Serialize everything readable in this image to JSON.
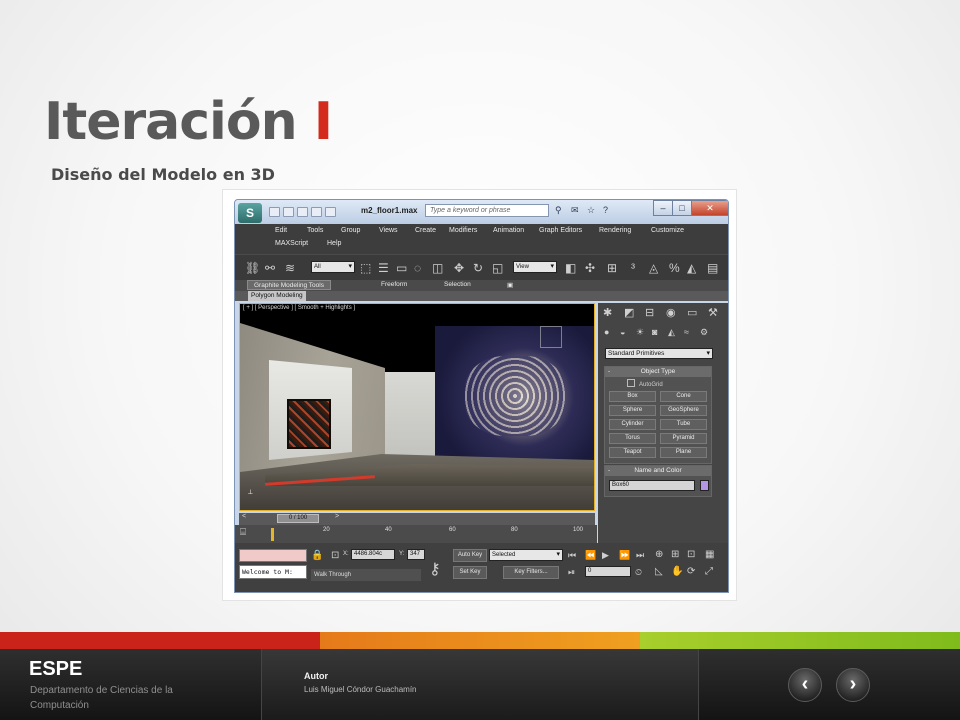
{
  "slide": {
    "title_main": "Iteración ",
    "title_accent": "I",
    "subtitle": "Diseño del Modelo en 3D"
  },
  "app": {
    "file_title": "m2_floor1.max",
    "search_placeholder": "Type a keyword or phrase",
    "menu": [
      "Edit",
      "Tools",
      "Group",
      "Views",
      "Create",
      "Modifiers",
      "Animation",
      "Graph Editors",
      "Rendering",
      "Customize",
      "MAXScript",
      "Help"
    ],
    "toolbar": {
      "filter_select": "All",
      "view_select": "View"
    },
    "ribbon_tabs": [
      "Graphite Modeling Tools",
      "Freeform",
      "Selection"
    ],
    "ribbon_sub": "Polygon Modeling",
    "viewport_label": "[ + ] [ Perspective ] [ Smooth + Highlights ]",
    "time_slider": "0 / 100",
    "ruler_ticks": [
      "20",
      "40",
      "60",
      "80",
      "100"
    ],
    "status": {
      "console": "Welcome to M:",
      "hint": "Walk Through",
      "x_value": "4486.804c",
      "y_value": "347",
      "auto_key": "Auto Key",
      "set_key": "Set Key",
      "key_mode": "Selected",
      "key_filters": "Key Filters...",
      "frame": "0"
    },
    "command_panel": {
      "category": "Standard Primitives",
      "object_type_title": "Object Type",
      "autogrid": "AutoGrid",
      "primitives": [
        "Box",
        "Cone",
        "Sphere",
        "GeoSphere",
        "Cylinder",
        "Tube",
        "Torus",
        "Pyramid",
        "Teapot",
        "Plane"
      ],
      "name_color_title": "Name and Color",
      "object_name": "Box60",
      "object_color": "#b596e4"
    }
  },
  "footer": {
    "org": "ESPE",
    "department": "Departamento de Ciencias de la Computación",
    "author_label": "Autor",
    "author_name": "Luis Miguel Cóndor Guachamín",
    "prev_icon": "chevron-left-icon",
    "next_icon": "chevron-right-icon"
  },
  "colors": {
    "accent_red": "#d42a1e",
    "bar_red": "#c9231a",
    "bar_orange": "#e98a1c",
    "bar_green": "#8dc21f"
  }
}
